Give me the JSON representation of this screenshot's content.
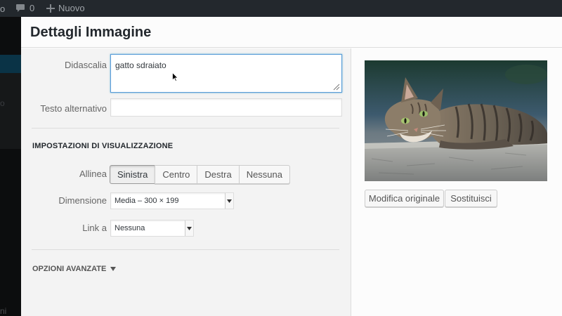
{
  "admin_bar": {
    "left_fragment": "o",
    "comments_count": "0",
    "new_label": "Nuovo"
  },
  "backdrop": {
    "fragment_o": "o",
    "fragment_ni": "ni"
  },
  "modal": {
    "title": "Dettagli Immagine"
  },
  "attachment": {
    "caption_label": "Didascalia",
    "caption_value": "gatto sdraiato",
    "alt_label": "Testo alternativo",
    "alt_value": ""
  },
  "display_settings": {
    "heading": "IMPOSTAZIONI DI VISUALIZZAZIONE",
    "align_label": "Allinea",
    "align_options": [
      "Sinistra",
      "Centro",
      "Destra",
      "Nessuna"
    ],
    "align_selected": "Sinistra",
    "size_label": "Dimensione",
    "size_value": "Media – 300 × 199",
    "link_label": "Link a",
    "link_value": "Nessuna"
  },
  "advanced": {
    "label": "OPZIONI AVANZATE"
  },
  "sidebar": {
    "edit_original_label": "Modifica originale",
    "replace_label": "Sostituisci"
  },
  "colors": {
    "admin_bar_bg": "#23282d",
    "focus_border": "#5b9dd9"
  }
}
